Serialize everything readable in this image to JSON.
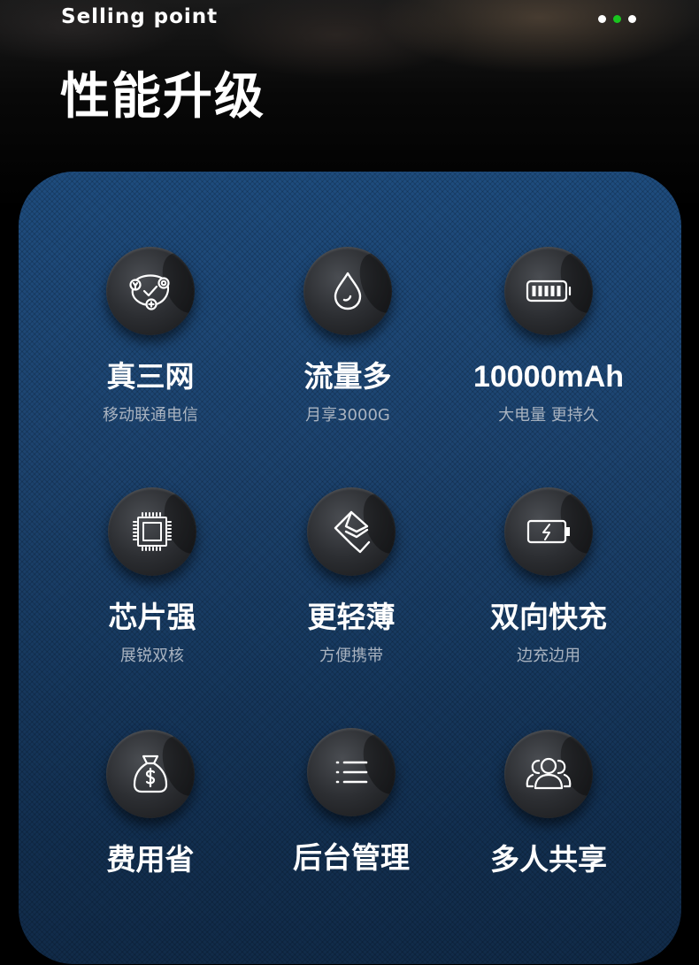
{
  "header": {
    "eyebrow": "Selling point",
    "title": "性能升级",
    "dots": [
      {
        "active": false
      },
      {
        "active": true
      },
      {
        "active": false
      }
    ]
  },
  "colors": {
    "accent_dot": "#19c51f",
    "panel_top": "#1e4c7e",
    "panel_bottom": "#112b49",
    "subtitle_text": "#a9b3c0"
  },
  "features": [
    {
      "icon": "network-check-icon",
      "title": "真三网",
      "subtitle": "移动联通电信"
    },
    {
      "icon": "water-drop-icon",
      "title": "流量多",
      "subtitle": "月享3000G"
    },
    {
      "icon": "battery-icon",
      "title": "10000mAh",
      "subtitle": "大电量 更持久"
    },
    {
      "icon": "chip-icon",
      "title": "芯片强",
      "subtitle": "展锐双核"
    },
    {
      "icon": "layers-icon",
      "title": "更轻薄",
      "subtitle": "方便携带"
    },
    {
      "icon": "charging-battery-icon",
      "title": "双向快充",
      "subtitle": "边充边用"
    },
    {
      "icon": "money-bag-icon",
      "title": "费用省",
      "subtitle": ""
    },
    {
      "icon": "list-icon",
      "title": "后台管理",
      "subtitle": ""
    },
    {
      "icon": "users-icon",
      "title": "多人共享",
      "subtitle": ""
    }
  ]
}
